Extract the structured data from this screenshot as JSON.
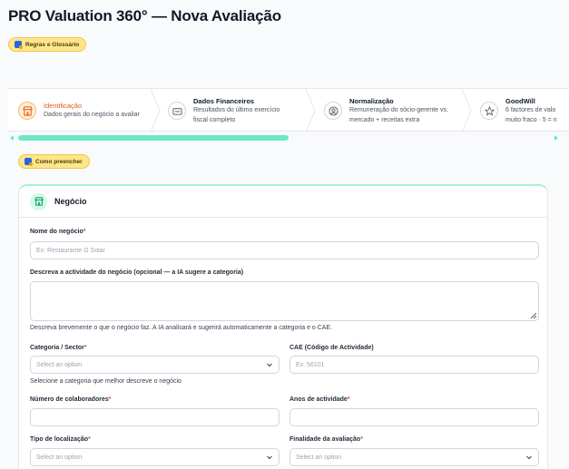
{
  "page": {
    "title": "PRO Valuation 360° — Nova Avaliação"
  },
  "buttons": {
    "rules": "Regras e Glossário",
    "how_to": "Como preencher"
  },
  "steps": [
    {
      "title": "Identificação",
      "desc1": "Dados gerais do negócio a avaliar",
      "desc2": "",
      "icon": "store-icon",
      "active": true
    },
    {
      "title": "Dados Financeiros",
      "desc1": "Resultados do último exercício",
      "desc2": "fiscal completo",
      "icon": "wallet-icon",
      "active": false
    },
    {
      "title": "Normalização",
      "desc1": "Remuneração do sócio-gerente vs.",
      "desc2": "mercado + receitas extra",
      "icon": "user-icon",
      "active": false
    },
    {
      "title": "GoodWill",
      "desc1": "6 factores de valo",
      "desc2": "muito fraco · 5 = n",
      "icon": "star-icon",
      "active": false
    }
  ],
  "colors": {
    "accent": "#6ee7c7",
    "active_step": "#ea580c",
    "required": "#ef4444",
    "pill": "#fde68a"
  },
  "section": {
    "title": "Negócio",
    "icon": "store-icon",
    "fields": {
      "business_name": {
        "label": "Nome do negócio",
        "required": "*",
        "placeholder": "Ex: Restaurante O Solar",
        "value": ""
      },
      "activity": {
        "label": "Descreva a actividade do negócio (opcional — a IA sugere a categoria)",
        "help": "Descreva brevemente o que o negócio faz. A IA analisará e sugerirá automaticamente a categoria e o CAE.",
        "value": ""
      },
      "category": {
        "label": "Categoria / Sector",
        "required": "*",
        "value": "Select an option",
        "help": "Selecione a categoria que melhor descreve o negócio"
      },
      "cae": {
        "label": "CAE (Código de Actividade)",
        "placeholder": "Ex: 56101",
        "value": ""
      },
      "employees": {
        "label": "Número de colaboradores",
        "required": "*",
        "value": ""
      },
      "years": {
        "label": "Anos de actividade",
        "required": "*",
        "value": ""
      },
      "location_type": {
        "label": "Tipo de localização",
        "required": "*",
        "value": "Select an option"
      },
      "purpose": {
        "label": "Finalidade da avaliação",
        "required": "*",
        "value": "Select an option"
      }
    }
  }
}
